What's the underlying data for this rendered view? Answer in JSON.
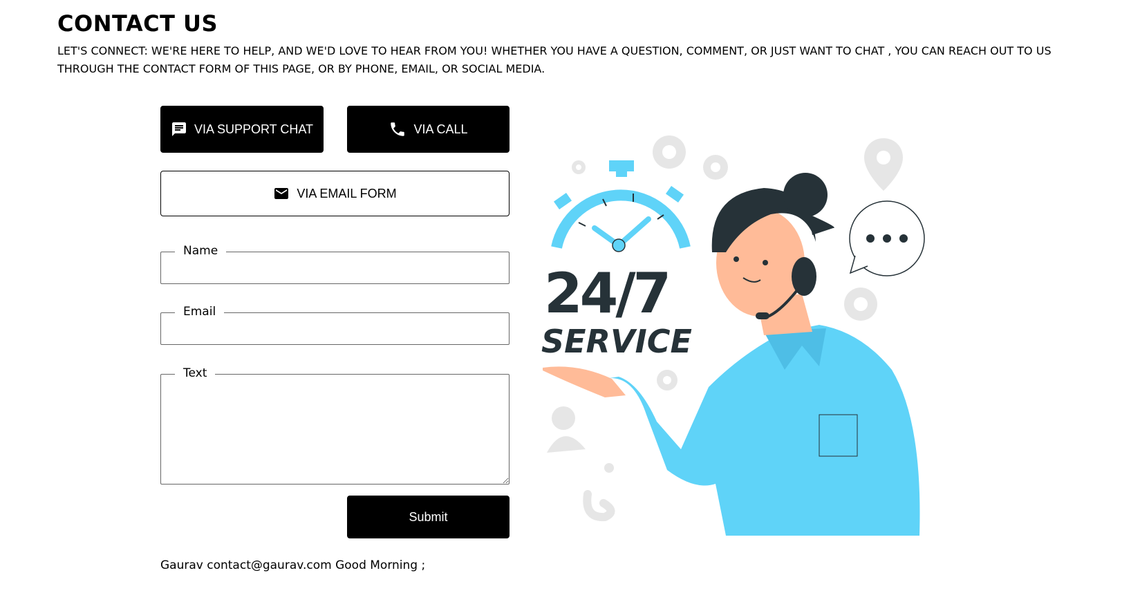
{
  "header": {
    "title": "CONTACT US",
    "intro": "LET'S CONNECT: WE'RE HERE TO HELP, AND WE'D LOVE TO HEAR FROM YOU! WHETHER YOU HAVE A QUESTION, COMMENT, OR JUST WANT TO CHAT , YOU CAN REACH OUT TO US THROUGH THE CONTACT FORM OF THIS PAGE, OR BY PHONE, EMAIL, OR SOCIAL MEDIA."
  },
  "contact_options": {
    "chat": {
      "label": "VIA SUPPORT CHAT",
      "icon": "chat-icon"
    },
    "call": {
      "label": "VIA CALL",
      "icon": "phone-icon"
    },
    "email": {
      "label": "VIA EMAIL FORM",
      "icon": "mail-icon"
    }
  },
  "form": {
    "name": {
      "legend": "Name",
      "value": ""
    },
    "email": {
      "legend": "Email",
      "value": ""
    },
    "text": {
      "legend": "Text",
      "value": ""
    },
    "submit_label": "Submit"
  },
  "footer": {
    "summary": "Gaurav contact@gaurav.com Good Morning ;"
  },
  "illustration": {
    "badge_number": "24/7",
    "badge_word": "SERVICE"
  },
  "colors": {
    "primary": "#000000",
    "background": "#ffffff",
    "accent": "#5fd3f8",
    "skin": "#ffbb98",
    "hair": "#263238",
    "gear": "#ebebeb"
  }
}
